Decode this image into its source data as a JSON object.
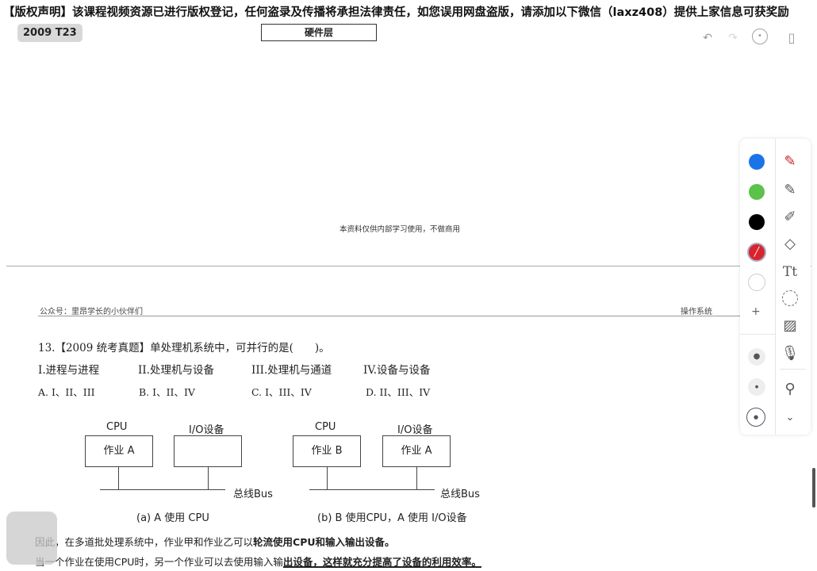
{
  "banner": "【版权声明】该课程视频资源已进行版权登记，任何盗录及传播将承担法律责任，如您误用网盘盗版，请添加以下微信（laxz408）提供上家信息可获奖励",
  "tag": "2009 T23",
  "hardware_layer": "硬件层",
  "page_footer": "本资料仅供内部学习使用，不做商用",
  "header_left": "公众号：里昂学长的小伙伴们",
  "header_right": "操作系统",
  "question": "13.【2009 统考真题】单处理机系统中，可并行的是(　　)。",
  "items": [
    "I.进程与进程",
    "II.处理机与设备",
    "III.处理机与通道",
    "IV.设备与设备"
  ],
  "options": [
    "A. I、II、III",
    "B. I、II、IV",
    "C. I、III、IV",
    "D. II、III、IV"
  ],
  "diagram": {
    "a": {
      "cpu": "CPU",
      "io": "I/O设备",
      "cpu_job": "作业 A",
      "io_job": "",
      "bus": "总线Bus",
      "caption": "(a)  A 使用 CPU"
    },
    "b": {
      "cpu": "CPU",
      "io": "I/O设备",
      "cpu_job": "作业 B",
      "io_job": "作业 A",
      "bus": "总线Bus",
      "caption": "(b)  B 使用CPU，A 使用 I/O设备"
    }
  },
  "para1_normal": "因此，在多道批处理系统中，作业甲和作业乙可以",
  "para1_bold": "轮流使用CPU和输入输出设备。",
  "para2_normal": "当一个作业在使用CPU时，另一个作业可以去使用输入输",
  "para2_underline": "出设备，这样就充分提高了设备的利用效率。",
  "colors": {
    "blue": "#1a73e8",
    "green": "#5cc24a",
    "black": "#000000",
    "red": "#d9232d",
    "white": "#ffffff"
  }
}
